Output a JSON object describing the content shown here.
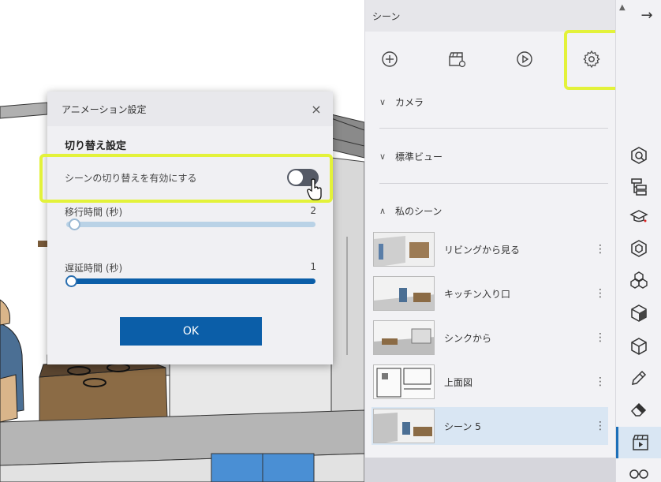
{
  "dialog": {
    "title": "アニメーション設定",
    "close_glyph": "×",
    "section_title": "切り替え設定",
    "toggle_label": "シーンの切り替えを有効にする",
    "toggle_on": false,
    "transition_label": "移行時間 (秒)",
    "transition_value": "2",
    "delay_label": "遅延時間 (秒)",
    "delay_value": "1",
    "ok_label": "OK"
  },
  "panel": {
    "title": "シーン",
    "toolbar": {
      "add_icon": "add-circle-icon",
      "scene_add_icon": "clapperboard-icon",
      "play_icon": "play-circle-icon",
      "settings_icon": "gear-icon"
    },
    "categories": [
      {
        "label": "カメラ",
        "expanded": false
      },
      {
        "label": "標準ビュー",
        "expanded": false
      },
      {
        "label": "私のシーン",
        "expanded": true
      }
    ],
    "scenes": [
      {
        "name": "リビングから見る",
        "selected": false
      },
      {
        "name": "キッチン入り口",
        "selected": false
      },
      {
        "name": "シンクから",
        "selected": false
      },
      {
        "name": "上面図",
        "selected": false
      },
      {
        "name": "シーン 5",
        "selected": true
      }
    ],
    "row_menu_glyph": "⋮"
  },
  "strip": {
    "top_glyph": "▲",
    "collapse_glyph": "→",
    "icons": [
      "cube-search-icon",
      "layers-tree-icon",
      "learn-cap-icon",
      "hexagon-icon",
      "cubes-icon",
      "cube-texture-icon",
      "components-icon",
      "pencil-icon",
      "eraser-icon",
      "scenes-icon",
      "glasses-icon"
    ],
    "active_icon": "scenes-icon"
  },
  "colors": {
    "highlight": "#e3f23a",
    "accent": "#0b5ea8",
    "selected_row": "#d9e6f3"
  }
}
